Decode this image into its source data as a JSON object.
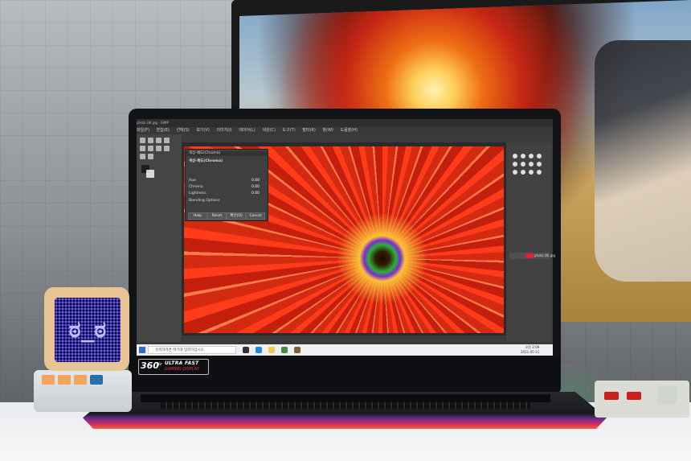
{
  "gimp": {
    "title_text": "photo (8).jpg · GIMP",
    "menu": [
      "파일(F)",
      "편집(E)",
      "선택(S)",
      "보기(V)",
      "이미지(I)",
      "레이어(L)",
      "색상(C)",
      "도구(T)",
      "필터(R)",
      "창(W)",
      "도움말(H)"
    ],
    "dialog": {
      "title": "색상-채도(Chroma)",
      "subtitle": "색상-채도(Chroma)",
      "rows": [
        {
          "label": "Hue",
          "value": "0.00"
        },
        {
          "label": "Chroma",
          "value": "0.00"
        },
        {
          "label": "Lightness",
          "value": "0.00"
        }
      ],
      "blending": "Blending Options",
      "buttons": {
        "help": "Help",
        "reset": "Reset",
        "ok": "확인(O)",
        "cancel": "Cancel"
      }
    },
    "layer_name": "photo (8).jpg"
  },
  "taskbar": {
    "search_placeholder": "검색하려면 여기에 입력하십시오.",
    "active_window": "photo (8).jpg (4.6 MB)",
    "clock_time": "오전 2:09",
    "clock_date": "2021-05-11"
  },
  "badge": {
    "hz": "360",
    "hz_unit": "Hz",
    "line1": "ULTRA FAST",
    "line2": "GAMING DISPLAY"
  },
  "colors": {
    "accent_red": "#e33333",
    "gimp_dark": "#3b3b3b",
    "rgb_glow": "#28e678"
  }
}
